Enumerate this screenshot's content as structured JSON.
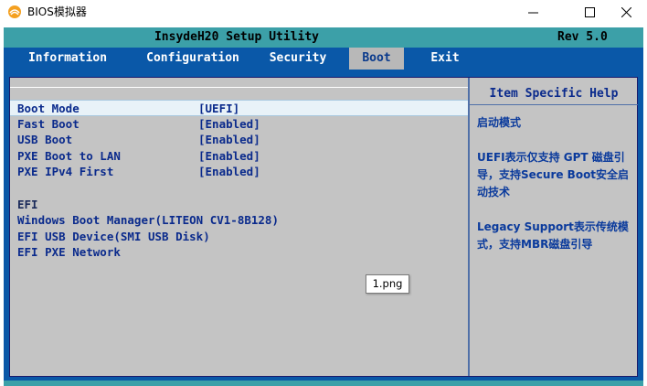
{
  "window": {
    "title": "BIOS模拟器",
    "minimize_glyph": "—",
    "maximize_glyph": "☐",
    "close_glyph": "✕",
    "icon": "app-logo-icon"
  },
  "bios": {
    "title": "InsydeH20 Setup Utility",
    "rev": "Rev 5.0",
    "tabs": [
      {
        "label": "Information"
      },
      {
        "label": "Configuration"
      },
      {
        "label": "Security"
      },
      {
        "label": "Boot",
        "active": true
      },
      {
        "label": "Exit"
      }
    ],
    "settings": [
      {
        "label": "Boot Mode",
        "value": "[UEFI]"
      },
      {
        "label": "Fast Boot",
        "value": "[Enabled]"
      },
      {
        "label": "USB Boot",
        "value": "[Enabled]"
      },
      {
        "label": "PXE Boot to LAN",
        "value": "[Enabled]"
      },
      {
        "label": "PXE IPv4 First",
        "value": "[Enabled]"
      }
    ],
    "efi_group": "EFI",
    "efi_items": [
      {
        "label": "Windows Boot Manager(LITEON CV1-8B128)"
      },
      {
        "label": "EFI USB Device(SMI USB Disk)"
      },
      {
        "label": "EFI PXE Network"
      }
    ],
    "help": {
      "title": "Item Specific Help",
      "paragraphs": [
        "启动模式",
        "UEFI表示仅支持 GPT 磁盘引导，支持Secure Boot安全启动技术",
        "Legacy Support表示传统模式，支持MBR磁盘引导"
      ]
    },
    "tooltip": "1.png"
  },
  "colors": {
    "bios_blue": "#0a58a8",
    "header_teal": "#3ca0a8",
    "panel_gray": "#c4c4c4",
    "text_blue": "#0a2a8c"
  }
}
